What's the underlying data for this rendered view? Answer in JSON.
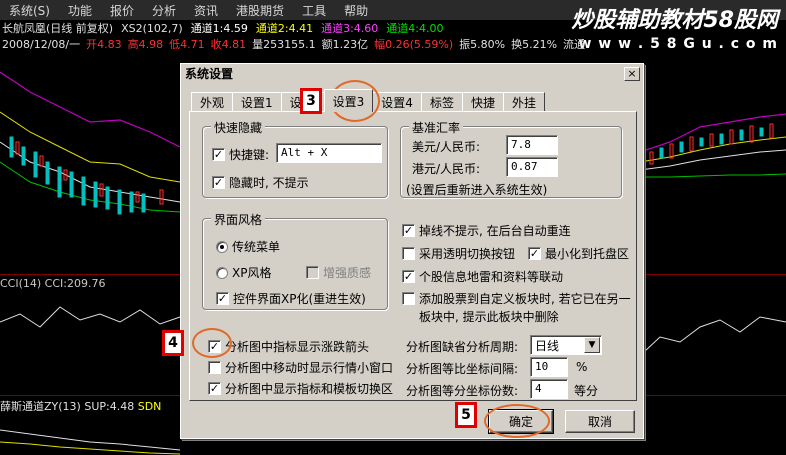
{
  "menubar": {
    "items": [
      "系统(S)",
      "功能",
      "报价",
      "分析",
      "资讯",
      "港股期货",
      "工具",
      "帮助"
    ]
  },
  "watermark": {
    "main": "炒股辅助教材58股网",
    "url": "w w w . 5 8 G u . c o m"
  },
  "info_line1": {
    "name": "长航凤凰(日线 前复权)",
    "xs2": "XS2(102,7)",
    "ch1": "通道1:4.59",
    "ch2": "通道2:4.41",
    "ch3": "通道3:4.60",
    "ch4": "通道4:4.00"
  },
  "info_line2": {
    "date": "2008/12/08/一",
    "open": "开4.83",
    "high": "高4.98",
    "low": "低4.71",
    "close": "收4.81",
    "vol": "量253155.1",
    "amount": "额1.23亿",
    "change": "幅0.26(5.59%)",
    "amp": "振5.80%",
    "turnover": "换5.21%",
    "flow": "流通"
  },
  "cci": {
    "label": "CCI(14)  CCI:209.76"
  },
  "xue": {
    "label": "薛斯通道ZY(13)",
    "sup": "SUP:4.48",
    "sdn": "SDN"
  },
  "dialog": {
    "title": "系统设置",
    "close_glyph": "×",
    "tabs": [
      "外观",
      "设置1",
      "设",
      "设置3",
      "设置4",
      "标签",
      "快捷",
      "外挂"
    ],
    "active_tab": "设置3",
    "quick_hide": {
      "title": "快速隐藏",
      "hotkey_label": "快捷键:",
      "hotkey_value": "Alt + X",
      "no_prompt_label": "隐藏时, 不提示"
    },
    "rates": {
      "title": "基准汇率",
      "usd_label": "美元/人民币:",
      "usd_value": "7.8",
      "hkd_label": "港元/人民币:",
      "hkd_value": "0.87",
      "note": "(设置后重新进入系统生效)"
    },
    "style": {
      "title": "界面风格",
      "classic_label": "传统菜单",
      "xp_label": "XP风格",
      "enhanced_label": "增强质感",
      "xp_controls_label": "控件界面XP化(重进生效)"
    },
    "options": {
      "reconnect_label": "掉线不提示, 在后台自动重连",
      "transparent_label": "采用透明切换按钮",
      "minimize_tray_label": "最小化到托盘区",
      "mine_label": "个股信息地雷和资料等联动",
      "add_block_label_1": "添加股票到自定义板块时, 若它已在另一",
      "add_block_label_2": "板块中, 提示此板块中删除"
    },
    "chart_opts": {
      "arrow_label": "分析图中指标显示涨跌箭头",
      "mini_window_label": "分析图中移动时显示行情小窗口",
      "indicator_area_label": "分析图中显示指标和模板切换区",
      "period_label": "分析图缺省分析周期:",
      "period_value": "日线",
      "ratio_label": "分析图等比坐标间隔:",
      "ratio_value": "10",
      "ratio_unit": "%",
      "divide_label": "分析图等分坐标份数:",
      "divide_value": "4",
      "divide_unit": "等分"
    },
    "ok_label": "确定",
    "cancel_label": "取消"
  },
  "callouts": {
    "step3": "3",
    "step4": "4",
    "step5": "5"
  },
  "colors": {
    "accent_red": "#e00000",
    "ellipse": "#e06a2a",
    "dialog_bg": "#d4d0c8"
  }
}
